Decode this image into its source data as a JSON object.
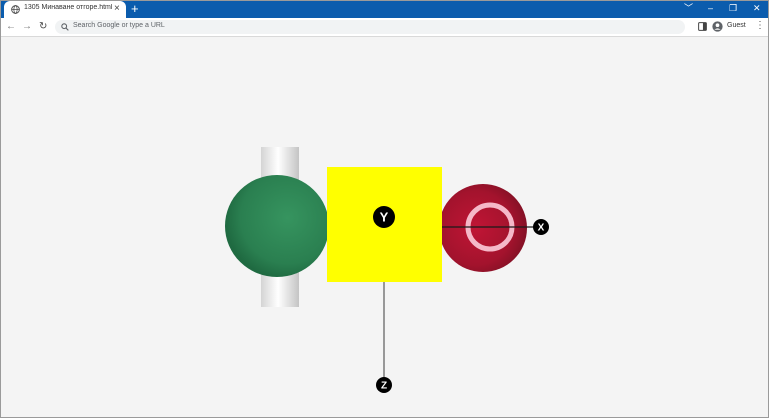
{
  "browser": {
    "tab_title": "1305 Минаване отгоре.html",
    "tab_close": "×",
    "new_tab": "+",
    "window_controls": [
      "﹀",
      "–",
      "❐",
      "✕"
    ],
    "nav": {
      "back": "←",
      "forward": "→",
      "reload": "↻"
    },
    "address_placeholder": "Search Google or type a URL",
    "profile_label": "Guest",
    "menu": "⋮",
    "colors": {
      "titlebar": "#0b5cad",
      "toolbar": "#ffffff",
      "page_bg": "#f4f4f4"
    }
  },
  "scene": {
    "axis_labels": {
      "x": "X",
      "y": "Y",
      "z": "Z"
    },
    "colors": {
      "green_sphere": "#2e8a58",
      "yellow_block": "#ffff00",
      "red_sphere": "#a3132d",
      "pink_ring": "#f5b8c8",
      "white_cylinder": "#f2f2f2",
      "axis_marker": "#000000"
    }
  }
}
